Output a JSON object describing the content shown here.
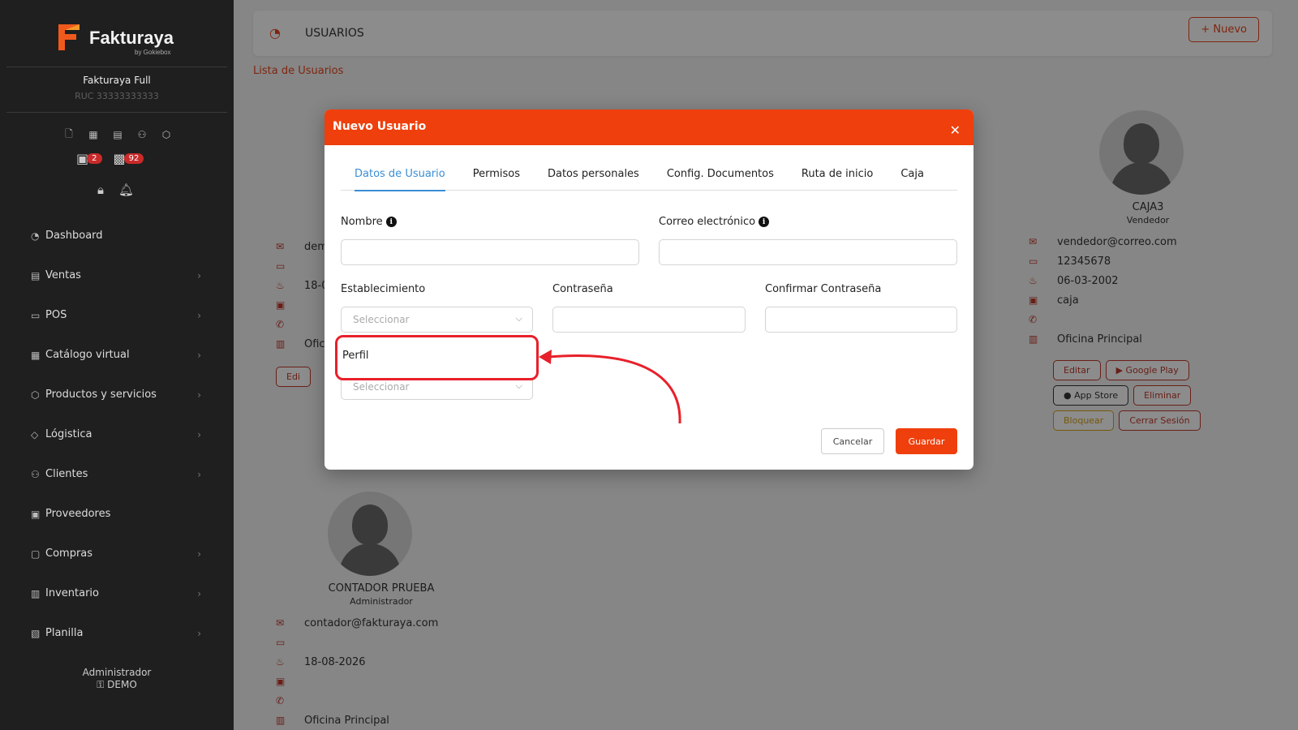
{
  "brand": {
    "name": "Fakturaya",
    "sub": "by Gokiebox"
  },
  "company": {
    "name": "Fakturaya Full",
    "ruc": "RUC 33333333333"
  },
  "notifications": {
    "calendar_count": "2",
    "packages_count": "92"
  },
  "menu": [
    {
      "label": "Dashboard",
      "icon": "dashboard-icon",
      "has_children": false
    },
    {
      "label": "Ventas",
      "icon": "receipt-icon",
      "has_children": true
    },
    {
      "label": "POS",
      "icon": "monitor-icon",
      "has_children": true
    },
    {
      "label": "Catálogo virtual",
      "icon": "store-icon",
      "has_children": true
    },
    {
      "label": "Productos y servicios",
      "icon": "box-icon",
      "has_children": true
    },
    {
      "label": "Lógistica",
      "icon": "tag-icon",
      "has_children": true
    },
    {
      "label": "Clientes",
      "icon": "users-icon",
      "has_children": true
    },
    {
      "label": "Proveedores",
      "icon": "briefcase-icon",
      "has_children": false
    },
    {
      "label": "Compras",
      "icon": "bag-icon",
      "has_children": true
    },
    {
      "label": "Inventario",
      "icon": "book-icon",
      "has_children": true
    },
    {
      "label": "Planilla",
      "icon": "id-badge-icon",
      "has_children": true
    }
  ],
  "user": {
    "role": "Administrador",
    "name": "DEMO"
  },
  "header": {
    "title": "USUARIOS",
    "new_button": "+ Nuevo"
  },
  "breadcrumb": "Lista de Usuarios",
  "cards": {
    "left_partial": {
      "email": "dem",
      "date": "18-0",
      "office": "Ofic",
      "edit": "Edi"
    },
    "caja3": {
      "name": "CAJA3",
      "role": "Vendedor",
      "email": "vendedor@correo.com",
      "doc": "12345678",
      "birth": "06-03-2002",
      "job": "caja",
      "phone": "",
      "office": "Oficina Principal",
      "buttons": {
        "edit": "Editar",
        "google_play": "Google Play",
        "app_store": "App Store",
        "delete": "Eliminar",
        "block": "Bloquear",
        "logout": "Cerrar Sesión"
      }
    },
    "contador": {
      "name": "CONTADOR PRUEBA",
      "role": "Administrador",
      "email": "contador@fakturaya.com",
      "doc": "",
      "birth": "18-08-2026",
      "job": "",
      "phone": "",
      "office": "Oficina Principal"
    }
  },
  "modal": {
    "title": "Nuevo Usuario",
    "tabs": [
      "Datos de Usuario",
      "Permisos",
      "Datos personales",
      "Config. Documentos",
      "Ruta de inicio",
      "Caja"
    ],
    "active_tab": "Datos de Usuario",
    "fields": {
      "nombre": {
        "label": "Nombre",
        "value": ""
      },
      "correo": {
        "label": "Correo electrónico",
        "value": ""
      },
      "establecimiento": {
        "label": "Establecimiento",
        "placeholder": "Seleccionar"
      },
      "contrasena": {
        "label": "Contraseña",
        "value": ""
      },
      "confirmar": {
        "label": "Confirmar Contraseña",
        "value": ""
      },
      "perfil": {
        "label": "Perfil",
        "placeholder": "Seleccionar"
      }
    },
    "buttons": {
      "cancel": "Cancelar",
      "save": "Guardar"
    }
  },
  "colors": {
    "accent": "#ef3f0c",
    "sidebar": "#1f1f1f",
    "tab_active": "#3a8ed6",
    "annotation": "#e8202a"
  }
}
